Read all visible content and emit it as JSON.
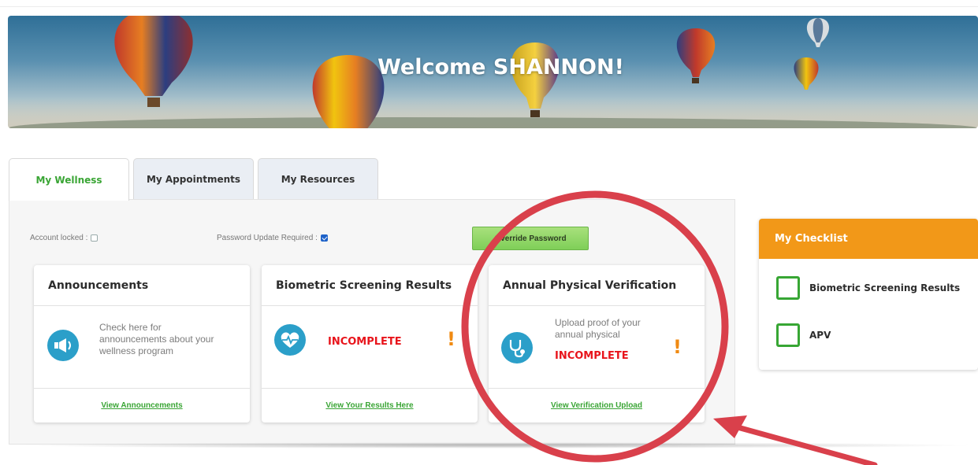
{
  "banner": {
    "welcome_text": "Welcome SHANNON!"
  },
  "tabs": [
    {
      "label": "My Wellness",
      "active": true
    },
    {
      "label": "My Appointments",
      "active": false
    },
    {
      "label": "My Resources",
      "active": false
    }
  ],
  "account": {
    "locked_label": "Account locked :",
    "locked_checked": false,
    "password_update_label": "Password Update Required :",
    "password_update_checked": true,
    "override_button": "Override Password"
  },
  "cards": [
    {
      "title": "Announcements",
      "icon": "megaphone-icon",
      "description_lines": [
        "Check here for",
        "announcements about your",
        "wellness program"
      ],
      "link": "View Announcements"
    },
    {
      "title": "Biometric Screening Results",
      "icon": "heart-pulse-icon",
      "status": "INCOMPLETE",
      "alert": "!",
      "link": "View Your Results Here"
    },
    {
      "title": "Annual Physical Verification",
      "icon": "stethoscope-icon",
      "description_lines": [
        "Upload proof of your",
        "annual physical"
      ],
      "status": "INCOMPLETE",
      "alert": "!",
      "link": "View Verification Upload"
    }
  ],
  "checklist": {
    "title": "My Checklist",
    "items": [
      {
        "label": "Biometric Screening Results",
        "checked": false
      },
      {
        "label": "APV",
        "checked": false
      }
    ]
  },
  "colors": {
    "accent_green": "#3aa535",
    "checklist_orange": "#f29818",
    "status_red": "#e8141b",
    "icon_blue": "#2b9fc9",
    "annotation_red": "#d9404b"
  }
}
